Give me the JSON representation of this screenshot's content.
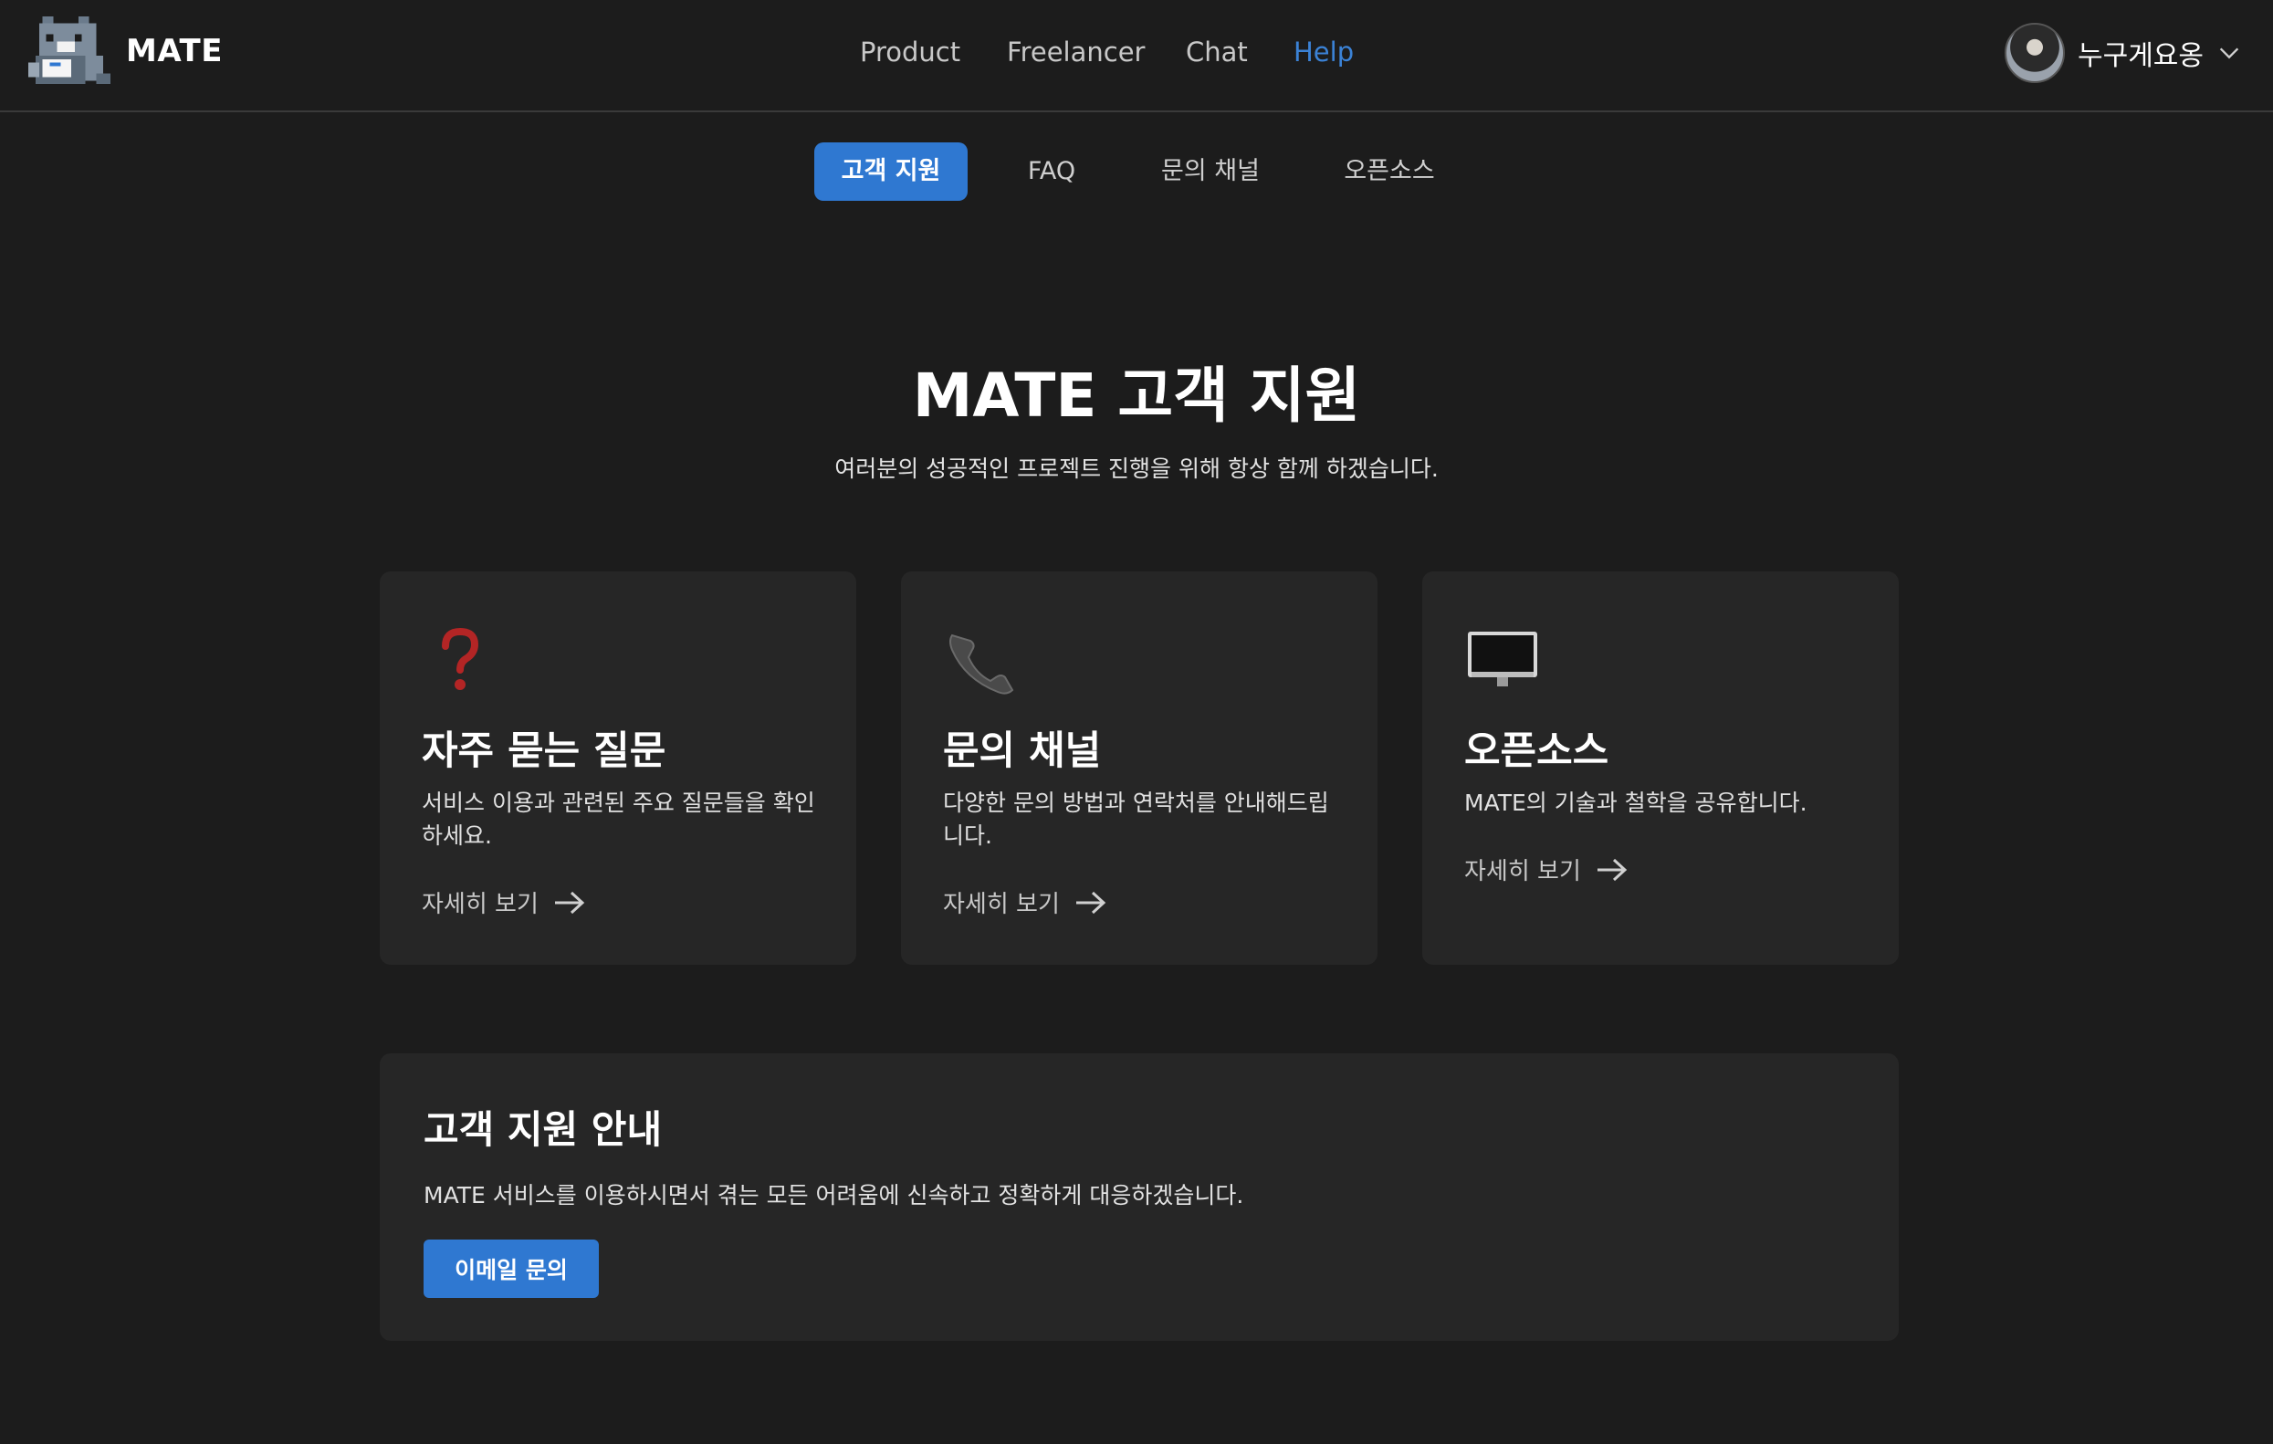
{
  "header": {
    "brand": "MATE",
    "logo_icon": "pixel-cat-logo",
    "nav": [
      {
        "label": "Product"
      },
      {
        "label": "Freelancer"
      },
      {
        "label": "Chat"
      },
      {
        "label": "Help",
        "active": true
      }
    ],
    "user": {
      "name": "누구게요옹",
      "avatar_icon": "user-avatar",
      "menu_icon": "chevron-down-icon"
    }
  },
  "tabs": [
    {
      "label": "고객 지원",
      "active": true
    },
    {
      "label": "FAQ"
    },
    {
      "label": "문의 채널"
    },
    {
      "label": "오픈소스"
    }
  ],
  "hero": {
    "title": "MATE 고객 지원",
    "subtitle": "여러분의 성공적인 프로젝트 진행을 위해 항상 함께 하겠습니다."
  },
  "cards": [
    {
      "icon": "question-mark-icon",
      "title": "자주 묻는 질문",
      "description": "서비스 이용과 관련된 주요 질문들을 확인하세요.",
      "link": "자세히 보기"
    },
    {
      "icon": "telephone-icon",
      "title": "문의 채널",
      "description": "다양한 문의 방법과 연락처를 안내해드립니다.",
      "link": "자세히 보기"
    },
    {
      "icon": "desktop-computer-icon",
      "title": "오픈소스",
      "description": "MATE의 기술과 철학을 공유합니다.",
      "link": "자세히 보기"
    }
  ],
  "info": {
    "title": "고객 지원 안내",
    "description": "MATE 서비스를 이용하시면서 겪는 모든 어려움에 신속하고 정확하게 대응하겠습니다.",
    "button": "이메일 문의"
  },
  "colors": {
    "background": "#1c1c1c",
    "card": "#262626",
    "accent": "#2f78d1",
    "active_nav": "#3b82d6"
  }
}
